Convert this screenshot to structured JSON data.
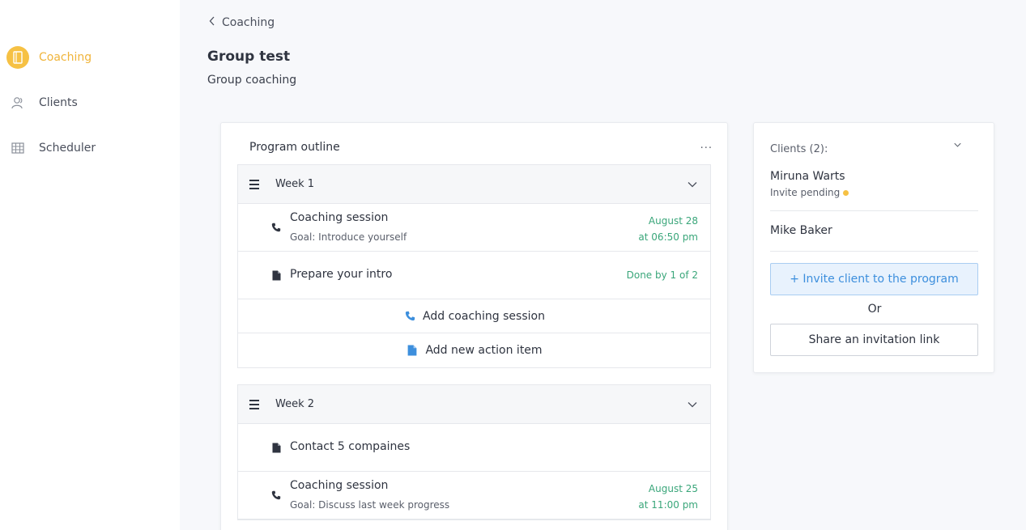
{
  "sidebar": {
    "items": [
      {
        "label": "Coaching",
        "icon": "notebook-icon",
        "active": true
      },
      {
        "label": "Clients",
        "icon": "users-icon",
        "active": false
      },
      {
        "label": "Scheduler",
        "icon": "calendar-grid-icon",
        "active": false
      }
    ]
  },
  "header": {
    "back_label": "Coaching",
    "title": "Group test",
    "subtitle": "Group coaching"
  },
  "outline": {
    "title": "Program outline",
    "more_label": "...",
    "weeks": [
      {
        "title": "Week 1",
        "items": [
          {
            "type": "session",
            "title": "Coaching session",
            "goal": "Goal: Introduce yourself",
            "date": "August 28",
            "time": "at 06:50 pm"
          },
          {
            "type": "action",
            "title": "Prepare your intro",
            "status": "Done by 1 of 2"
          }
        ],
        "add_session_label": "Add coaching session",
        "add_action_label": "Add new action item"
      },
      {
        "title": "Week 2",
        "items": [
          {
            "type": "action",
            "title": "Contact 5 compaines"
          },
          {
            "type": "session",
            "title": "Coaching session",
            "goal": "Goal: Discuss last week progress",
            "date": "August 25",
            "time": "at 11:00 pm"
          }
        ]
      }
    ]
  },
  "clients": {
    "header": "Clients (2):",
    "list": [
      {
        "name": "Miruna Warts",
        "status": "Invite pending"
      },
      {
        "name": "Mike Baker"
      }
    ],
    "invite_label": "+ Invite client to the program",
    "or_label": "Or",
    "share_label": "Share an invitation link"
  },
  "colors": {
    "accent": "#f6c144",
    "success": "#3aa67a",
    "link": "#3d8fdd",
    "pending": "#f6c144"
  }
}
